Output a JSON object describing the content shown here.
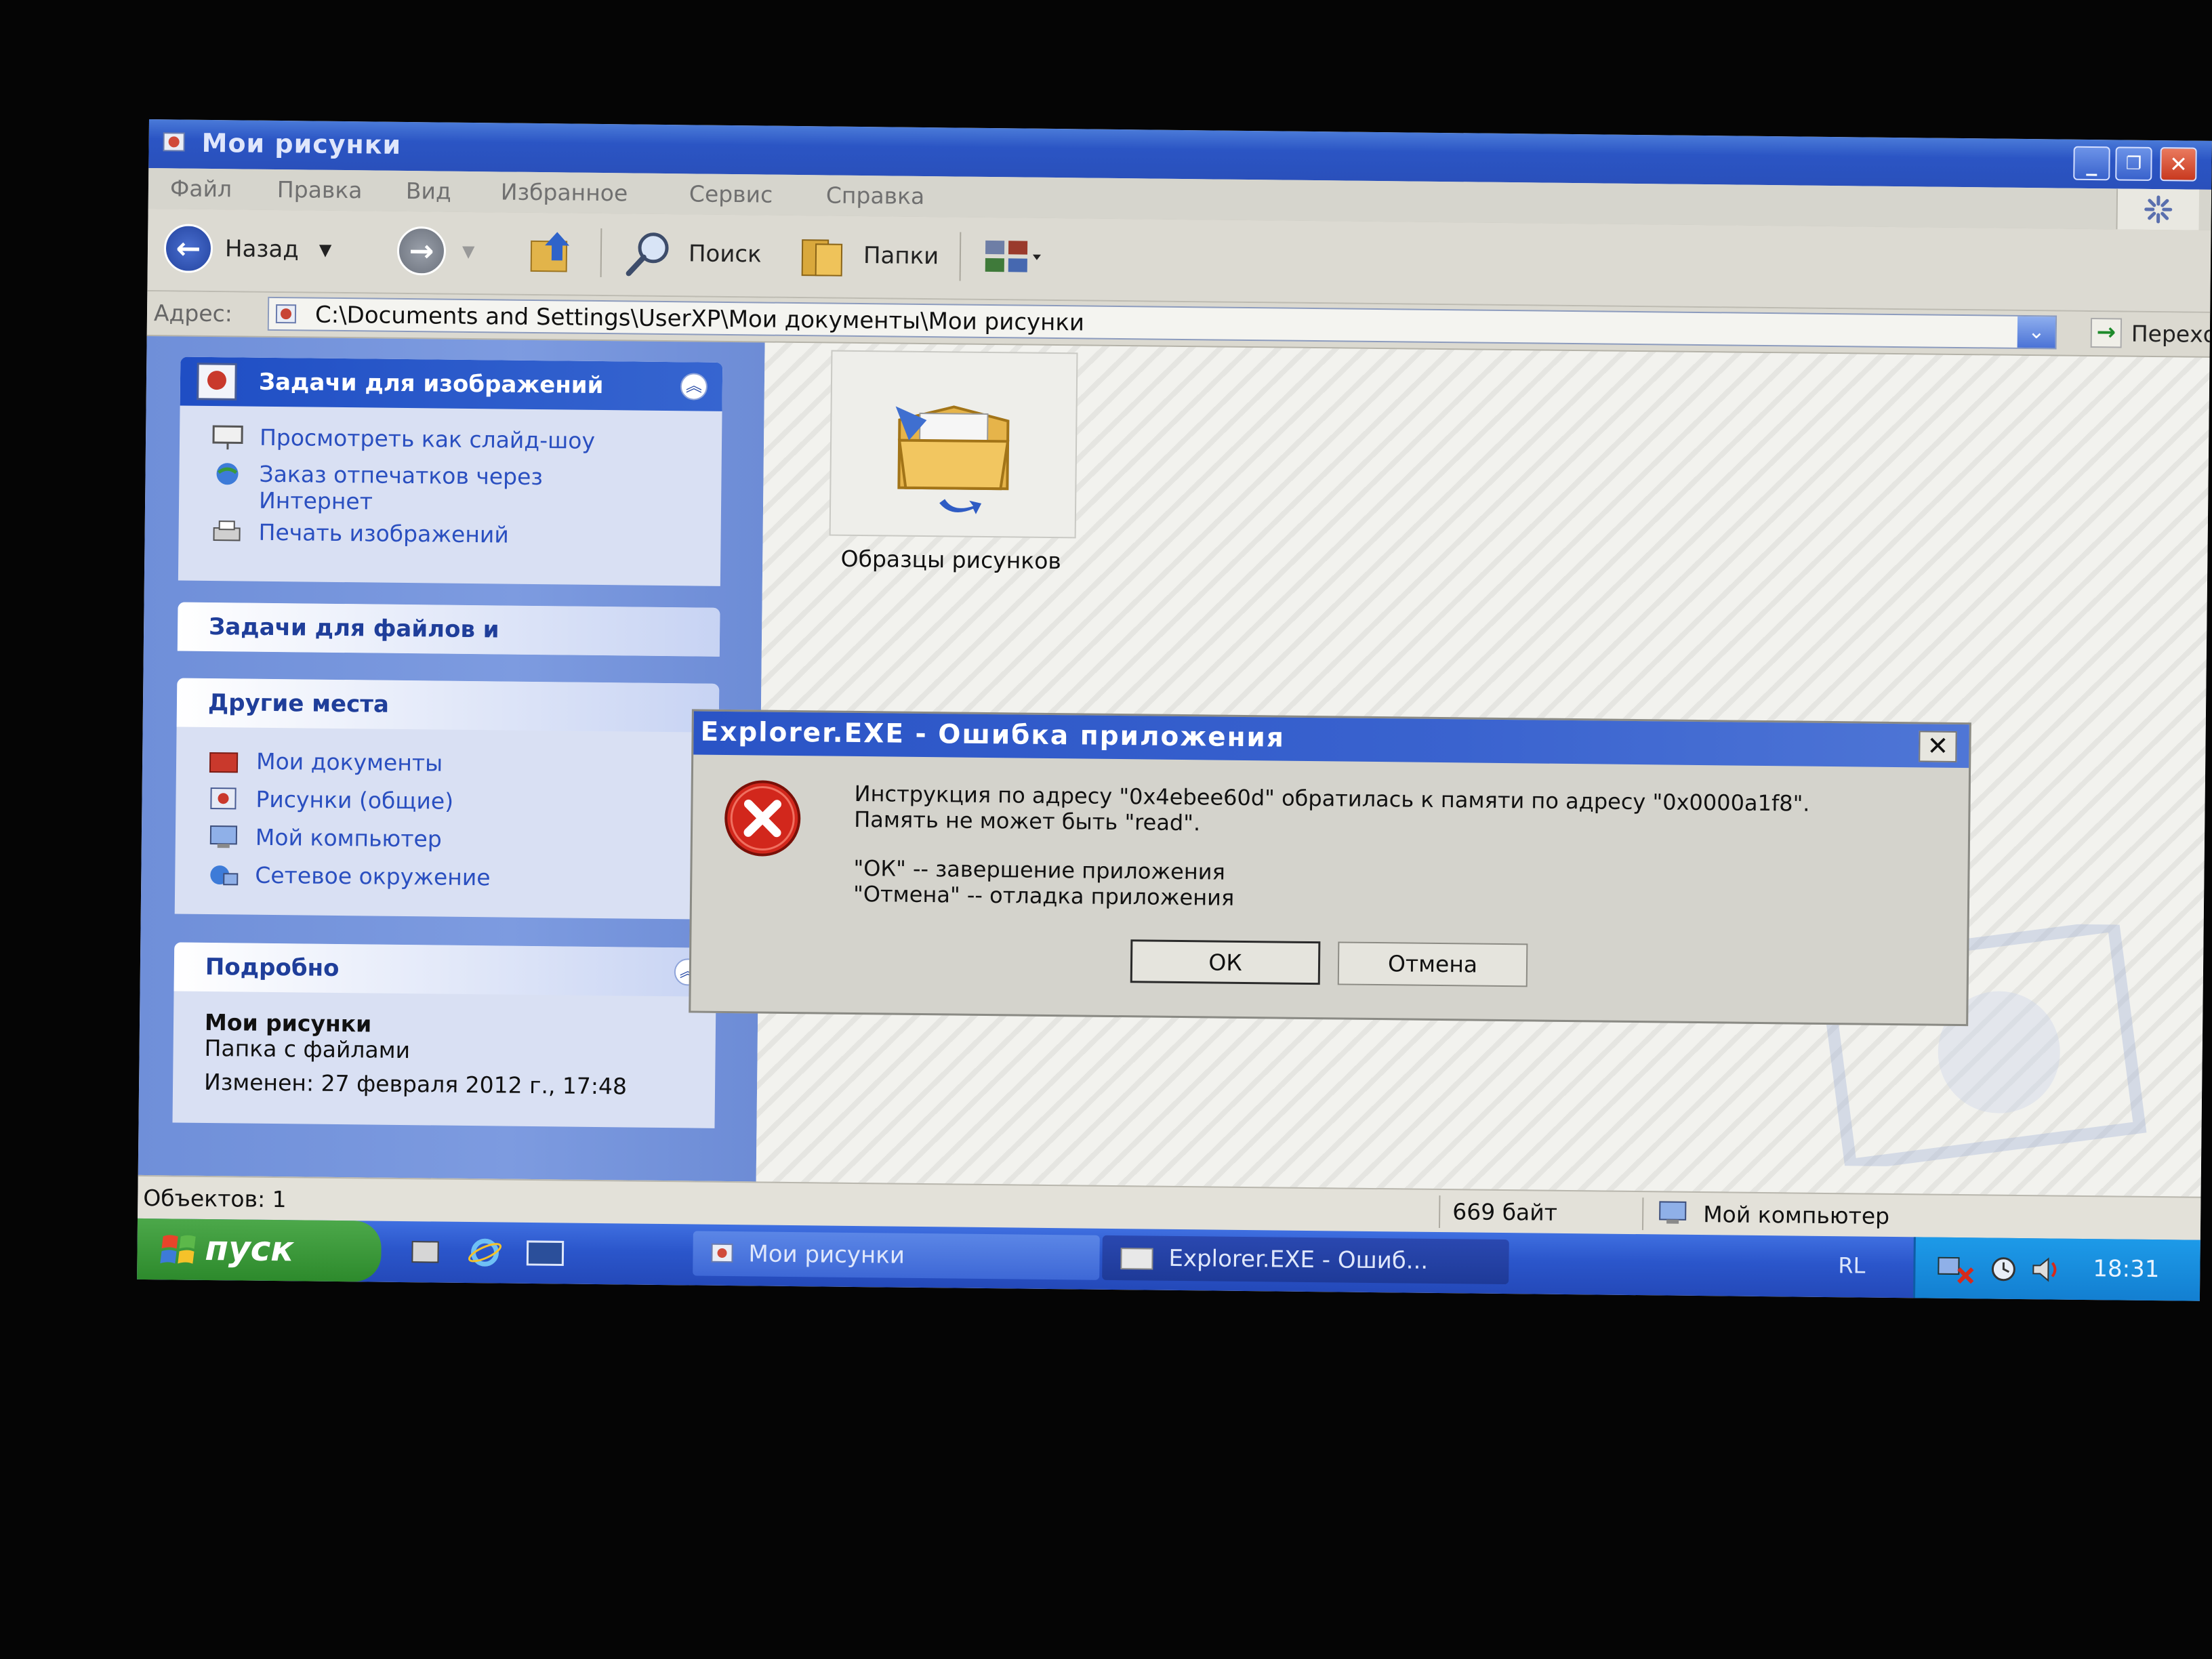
{
  "window": {
    "title": "Мои рисунки"
  },
  "menu": [
    "Файл",
    "Правка",
    "Вид",
    "Избранное",
    "Сервис",
    "Справка"
  ],
  "toolbar": {
    "back_label": "Назад",
    "search_label": "Поиск",
    "folders_label": "Папки"
  },
  "address": {
    "label": "Адрес:",
    "value": "C:\\Documents and Settings\\UserXP\\Мои документы\\Мои рисунки",
    "go_label": "Переход"
  },
  "sidebar": {
    "image_tasks": {
      "title": "Задачи для изображений",
      "items": [
        "Просмотреть как слайд-шоу",
        "Заказ отпечатков через Интернет",
        "Печать изображений"
      ]
    },
    "file_tasks": {
      "title": "Задачи для файлов и"
    },
    "other_places": {
      "title": "Другие места",
      "items": [
        "Мои документы",
        "Рисунки (общие)",
        "Мой компьютер",
        "Сетевое окружение"
      ]
    },
    "details": {
      "title": "Подробно",
      "name": "Мои рисунки",
      "type": "Папка с файлами",
      "modified": "Изменен: 27 февраля 2012 г., 17:48"
    }
  },
  "content": {
    "folder_name": "Образцы рисунков"
  },
  "status": {
    "objects": "Объектов: 1",
    "size": "669 байт",
    "location": "Мой компьютер"
  },
  "taskbar": {
    "start_label": "пуск",
    "tasks": [
      "Мои рисунки",
      "Explorer.EXE - Ошиб..."
    ],
    "language": "RL",
    "clock": "18:31"
  },
  "dialog": {
    "title": "Explorer.EXE - Ошибка приложения",
    "line1": "Инструкция по адресу \"0x4ebee60d\" обратилась к памяти по адресу \"0x0000a1f8\".",
    "line2": "Память не может быть \"read\".",
    "line3": "\"ОК\" -- завершение приложения",
    "line4": "\"Отмена\" -- отладка приложения",
    "ok_label": "ОК",
    "cancel_label": "Отмена"
  },
  "colors": {
    "title_blue": "#2b55c4",
    "sidebar_blue": "#7593dc",
    "taskbar_blue": "#2b56cb",
    "start_green": "#3a9a38",
    "error_red": "#d2271c"
  }
}
